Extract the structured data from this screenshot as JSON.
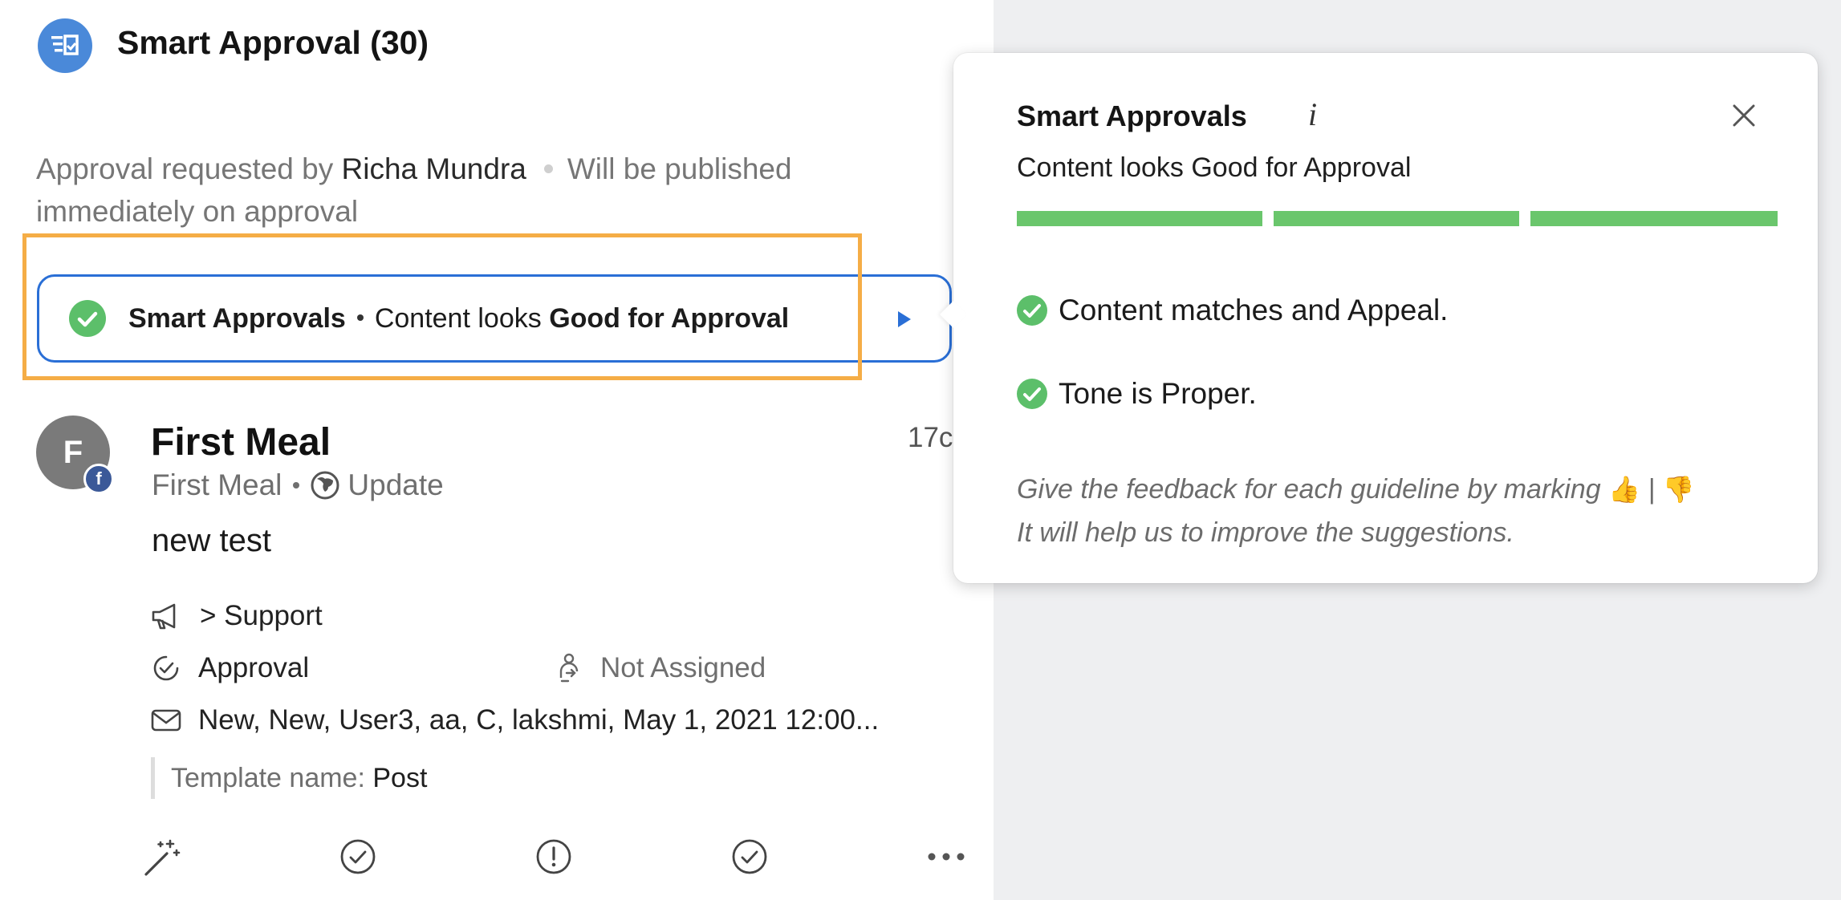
{
  "header": {
    "title": "Smart Approval (30)"
  },
  "approval_info": {
    "prefix": "Approval requested by",
    "requester": "Richa Mundra",
    "publish_note_line1": "Will be published",
    "publish_note_line2": "immediately on approval"
  },
  "smart_pill": {
    "label": "Smart Approvals",
    "text_prefix": "Content looks",
    "verdict": "Good for Approval"
  },
  "post": {
    "avatar_letter": "F",
    "title": "First Meal",
    "time": "17c",
    "account": "First Meal",
    "type": "Update",
    "body": "new test",
    "support": "> Support",
    "status": "Approval",
    "assignee": "Not Assigned",
    "tags": "New, New, User3, aa, C, lakshmi, May 1, 2021 12:00...",
    "template_label": "Template name:",
    "template_value": "Post"
  },
  "popover": {
    "title": "Smart Approvals",
    "info_glyph": "i",
    "status": "Content looks Good for Approval",
    "progress_segments_filled": 3,
    "progress_segments_total": 3,
    "checks": [
      {
        "text": "Content matches and Appeal."
      },
      {
        "text": "Tone is Proper."
      }
    ],
    "feedback_line1": "Give the feedback for each guideline by marking",
    "thumbs_up": "👍",
    "divider": "|",
    "thumbs_down": "👎",
    "feedback_line2": "It will help us to improve the suggestions."
  },
  "colors": {
    "accent_blue": "#2a6fd6",
    "success_green": "#5cbf6a",
    "highlight_orange": "#f5ad46"
  }
}
